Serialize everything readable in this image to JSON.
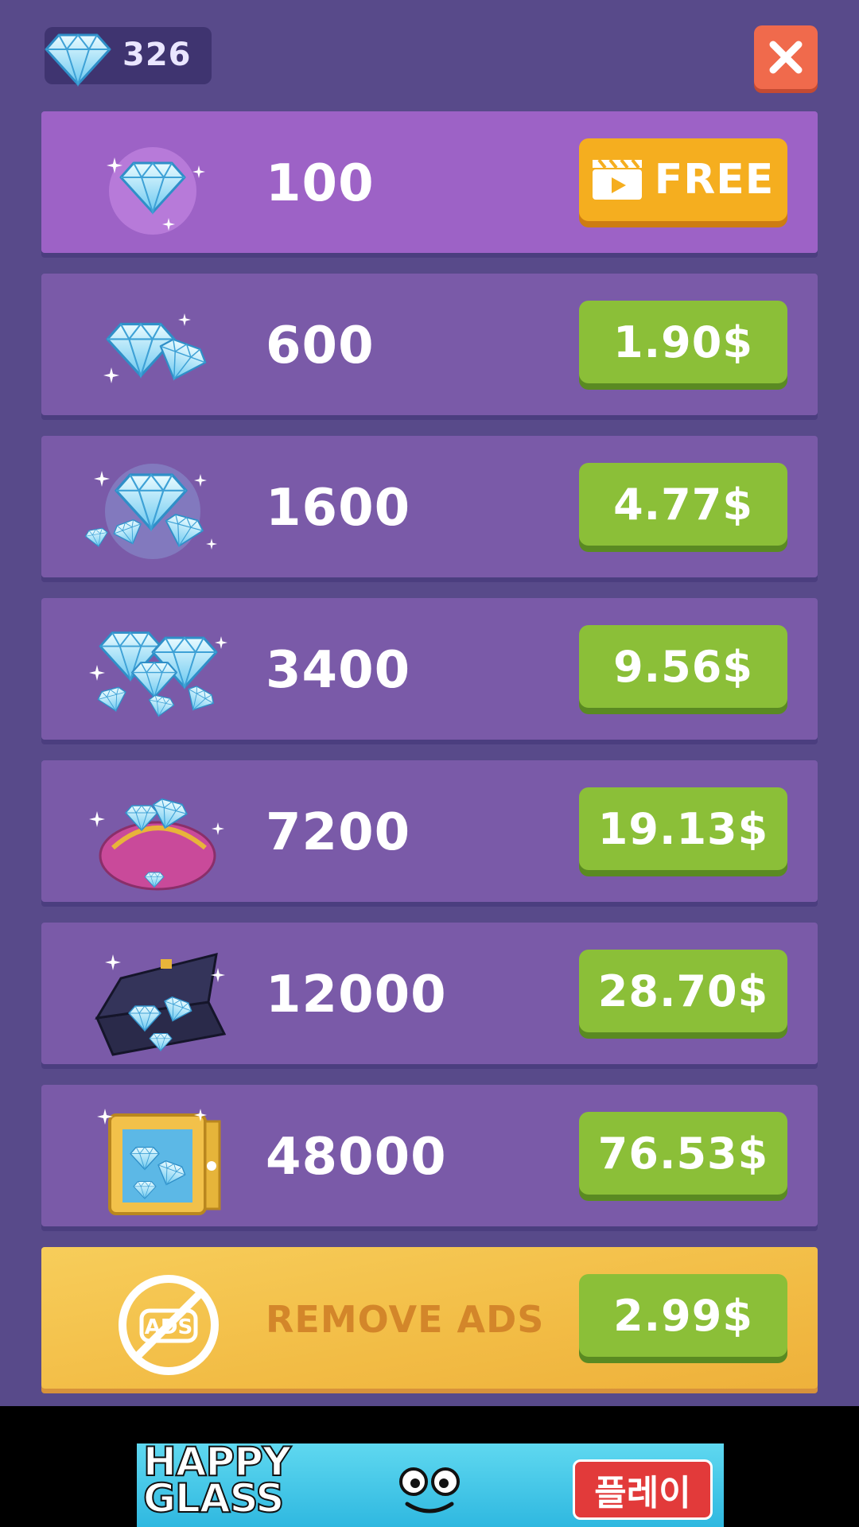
{
  "header": {
    "gem_count": "326",
    "gem_icon": "diamond-icon",
    "close_icon": "close-icon"
  },
  "offers": [
    {
      "amount": "100",
      "price": "FREE",
      "price_icon": "video-clapper-icon",
      "art": "single-diamond-icon"
    },
    {
      "amount": "600",
      "price": "1.90$",
      "art": "two-diamonds-icon"
    },
    {
      "amount": "1600",
      "price": "4.77$",
      "art": "diamond-pile-small-icon"
    },
    {
      "amount": "3400",
      "price": "9.56$",
      "art": "diamond-pile-large-icon"
    },
    {
      "amount": "7200",
      "price": "19.13$",
      "art": "diamond-purse-icon"
    },
    {
      "amount": "12000",
      "price": "28.70$",
      "art": "diamond-briefcase-icon"
    },
    {
      "amount": "48000",
      "price": "76.53$",
      "art": "diamond-safe-icon"
    }
  ],
  "remove_ads": {
    "icon_text": "ADS",
    "label": "REMOVE ADS",
    "price": "2.99$",
    "icon": "no-ads-icon"
  },
  "ad_banner": {
    "title": "HAPPY GLASS",
    "play_label": "플레이",
    "mascot": "smiling-glass-face-icon"
  },
  "colors": {
    "background": "#584a8a",
    "row": "#7a5aa8",
    "free_row": "#9d62c6",
    "price_button": "#8bbf38",
    "free_button": "#f5ae1f",
    "close_button": "#f06a4c",
    "remove_ads_row": "#f2bc45",
    "remove_ads_text": "#d3862a"
  }
}
